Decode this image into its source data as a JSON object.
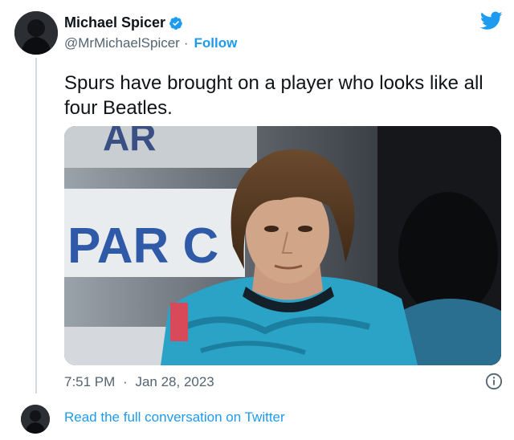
{
  "tweet": {
    "display_name": "Michael Spicer",
    "handle": "@MrMichaelSpicer",
    "separator": "·",
    "follow_label": "Follow",
    "text": "Spurs have brought on a player who looks like all four Beatles.",
    "time": "7:51 PM",
    "date_separator": "·",
    "date": "Jan 28, 2023",
    "media_sign_text": "PAR C",
    "media_sign_text_top": "AR"
  },
  "footer": {
    "read_link": "Read the full conversation on Twitter"
  },
  "colors": {
    "accent": "#1d9bf0",
    "secondary_text": "#536471",
    "primary_text": "#0f1419",
    "jersey": "#2aa3c7"
  },
  "icons": {
    "verified": "verified-badge-icon",
    "bird": "twitter-bird-icon",
    "info": "info-icon"
  }
}
